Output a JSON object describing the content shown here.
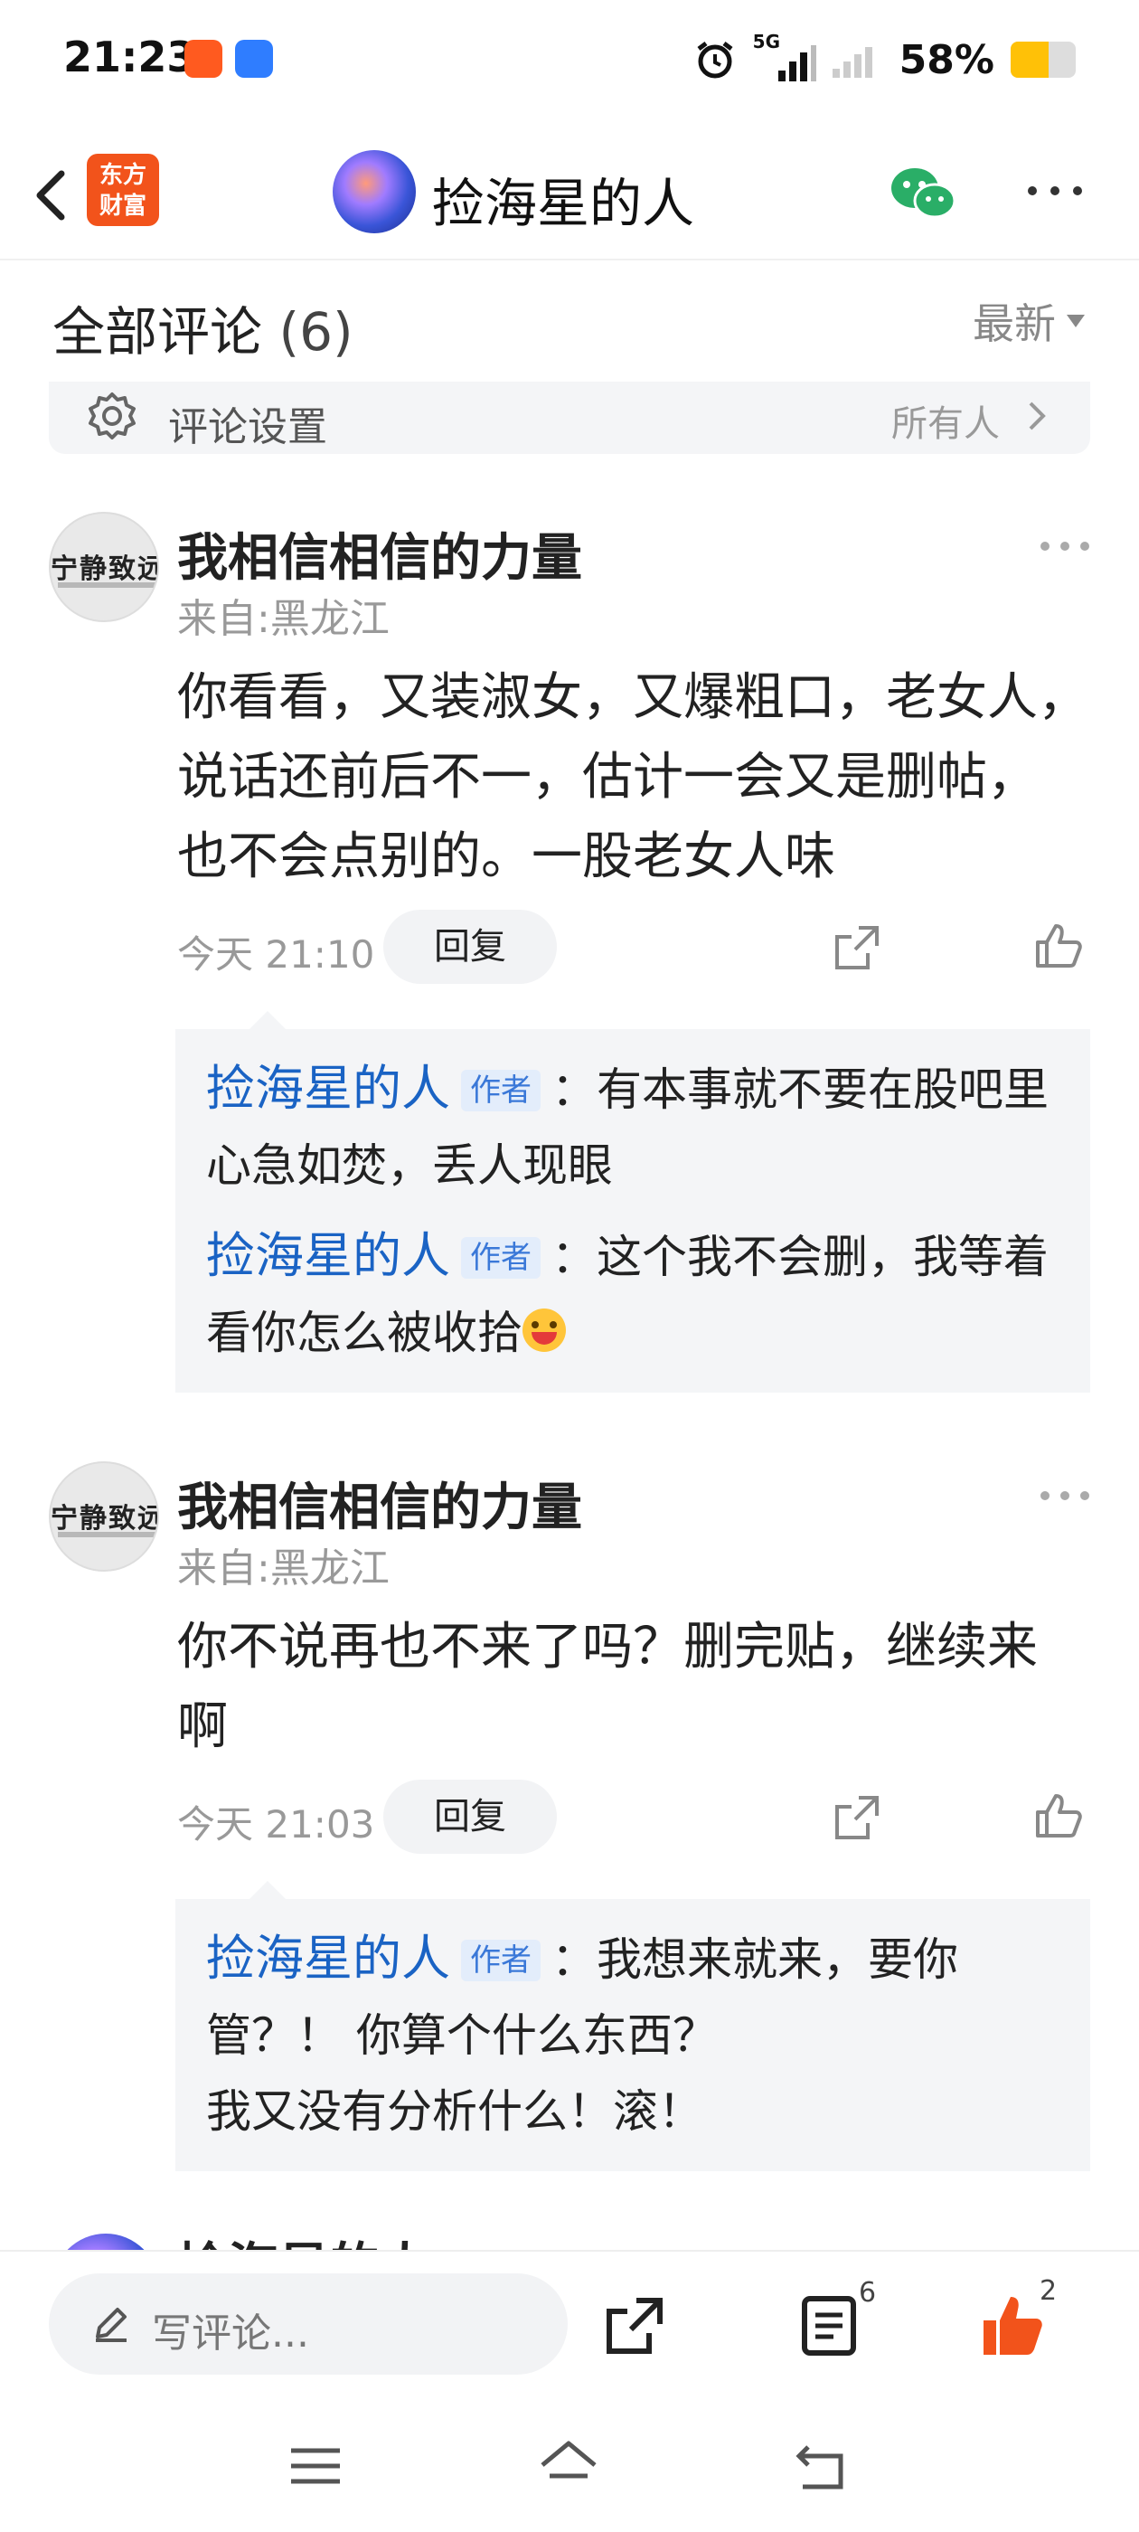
{
  "status_bar": {
    "time": "21:23",
    "network": "5G",
    "battery": "58%",
    "icons": [
      "alarm-icon",
      "signal-icon",
      "battery-icon"
    ]
  },
  "header": {
    "brand_line1": "东方",
    "brand_line2": "财富",
    "title": "捡海星的人",
    "icons": [
      "back-icon",
      "wechat-icon",
      "more-icon"
    ]
  },
  "comments_header": {
    "title": "全部评论",
    "count": "(6)",
    "sort_label": "最新"
  },
  "settings": {
    "label": "评论设置",
    "value": "所有人"
  },
  "comments": [
    {
      "name": "我相信相信的力量",
      "from": "来自:黑龙江",
      "avatar_text": "宁静致远",
      "text_lines": [
        "你看看，又装淑女，又爆粗口，老女人，",
        "说话还前后不一，估计一会又是删帖，",
        "也不会点别的。一股老女人味"
      ],
      "time": "今天 21:10",
      "reply_label": "回复",
      "replies": [
        {
          "name": "捡海星的人",
          "badge": "作者",
          "text": "：有本事就不要在股吧里心急如焚，丢人现眼"
        },
        {
          "name": "捡海星的人",
          "badge": "作者",
          "text": "：这个我不会删，我等着看你怎么被收拾"
        }
      ]
    },
    {
      "name": "我相信相信的力量",
      "from": "来自:黑龙江",
      "avatar_text": "宁静致远",
      "text_lines": [
        "你不说再也不来了吗？删完贴，继续来",
        "啊"
      ],
      "time": "今天 21:03",
      "reply_label": "回复",
      "replies": [
        {
          "name": "捡海星的人",
          "badge": "作者",
          "text": "：我想来就来，要你管？！ 你算个什么东西？"
        },
        {
          "name": "",
          "badge": "",
          "text": "我又没有分析什么！滚！"
        }
      ]
    }
  ],
  "partial_comment": {
    "name": "捡海星的人"
  },
  "bottom_bar": {
    "placeholder": "写评论...",
    "comment_count": "6",
    "like_count": "2"
  },
  "colors": {
    "accent_blue": "#1a63c4",
    "like_orange": "#f2531b",
    "brand_orange": "#f2531b"
  }
}
